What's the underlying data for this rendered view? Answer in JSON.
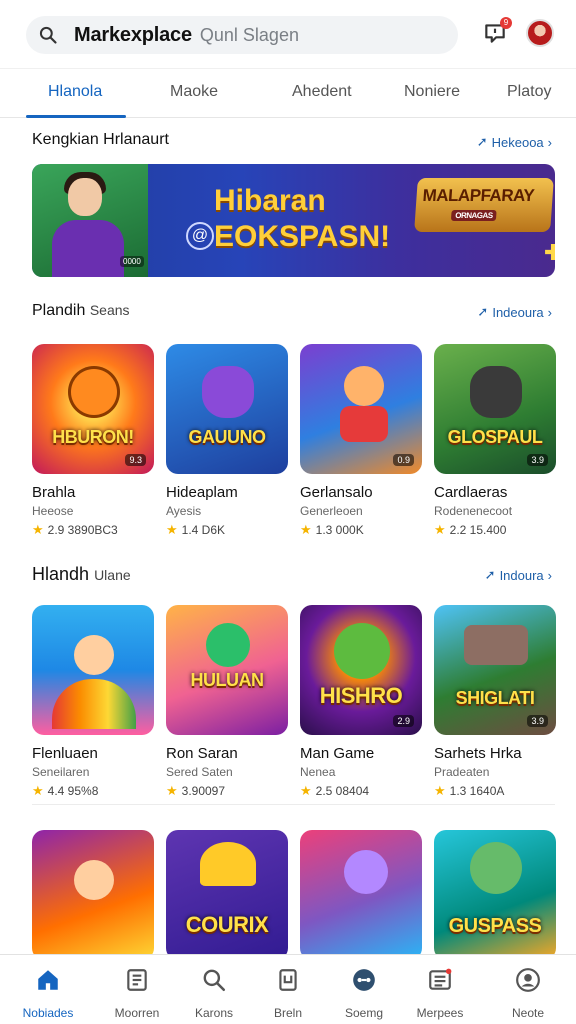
{
  "header": {
    "brand": "Markexplace",
    "search_placeholder": "Qunl Slagen",
    "notification_count": "9"
  },
  "tabs": [
    {
      "label": "Hlanola",
      "active": true
    },
    {
      "label": "Maoke",
      "active": false
    },
    {
      "label": "Ahedent",
      "active": false
    },
    {
      "label": "Noniere",
      "active": false
    },
    {
      "label": "Platoy",
      "active": false
    }
  ],
  "featured": {
    "title": "Kengkian Hrlanaurt",
    "link": "Hekeooa",
    "banner": {
      "headline_1": "Hibaran",
      "headline_2": "EOKSPASN!",
      "logo": "MALAPFARAY",
      "logo_sub": "ORNAGAS",
      "tag": "0000"
    }
  },
  "section1": {
    "title": "Plandih",
    "subtitle": "Seans",
    "link": "Indeoura",
    "apps": [
      {
        "name": "Brahla",
        "dev": "Heeose",
        "rating": "2.9 3890BC3",
        "logo": "HBURON!",
        "badge": "9.3"
      },
      {
        "name": "Hideaplam",
        "dev": "Ayesis",
        "rating": "1.4 D6K",
        "logo": "GAUUNO",
        "badge": ""
      },
      {
        "name": "Gerlansalo",
        "dev": "Generleoen",
        "rating": "1.3 000K",
        "logo": "",
        "badge": "0.9"
      },
      {
        "name": "Cardlaeras",
        "dev": "Rodenenecoot",
        "rating": "2.2 15.400",
        "logo": "GLOSPAUL",
        "badge": "3.9"
      }
    ]
  },
  "section2": {
    "title": "Hlandh",
    "subtitle": "Ulane",
    "link": "Indoura",
    "apps": [
      {
        "name": "Flenluaen",
        "dev": "Seneilaren",
        "rating": "4.4 95%8",
        "logo": "",
        "badge": ""
      },
      {
        "name": "Ron Saran",
        "dev": "Sered Saten",
        "rating": "3.90097",
        "logo": "HULUAN",
        "badge": ""
      },
      {
        "name": "Man Game",
        "dev": "Nenea",
        "rating": "2.5 08404",
        "logo": "HISHRO",
        "badge": "2.9"
      },
      {
        "name": "Sarhets Hrka",
        "dev": "Pradeaten",
        "rating": "1.3 1640A",
        "logo": "SHIGLATI",
        "badge": "3.9"
      }
    ]
  },
  "section3": {
    "apps": [
      {
        "logo": ""
      },
      {
        "logo": "COURIX"
      },
      {
        "logo": ""
      },
      {
        "logo": "GUSPASS"
      }
    ]
  },
  "bottom_nav": [
    {
      "label": "Nobiades",
      "icon": "home-icon",
      "active": true
    },
    {
      "label": "Moorren",
      "icon": "document-icon",
      "active": false
    },
    {
      "label": "Karons",
      "icon": "search-icon",
      "active": false
    },
    {
      "label": "Breln",
      "icon": "tablet-icon",
      "active": false
    },
    {
      "label": "Soemg",
      "icon": "gamepad-icon",
      "active": false
    },
    {
      "label": "Merpees",
      "icon": "list-icon",
      "active": false
    },
    {
      "label": "Neote",
      "icon": "profile-icon",
      "active": false
    }
  ],
  "colors": {
    "accent": "#1565c0",
    "star": "#f5b400",
    "badge_red": "#e53935"
  }
}
